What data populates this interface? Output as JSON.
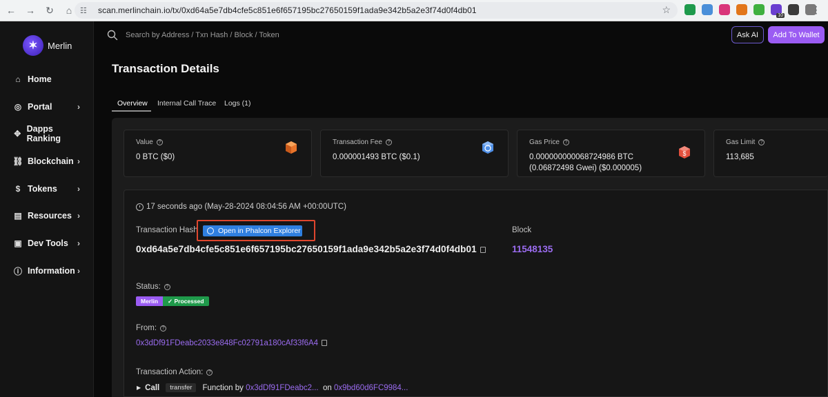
{
  "browser": {
    "url": "scan.merlinchain.io/tx/0xd64a5e7db4cfe5c851e6f657195bc27650159f1ada9e342b5a2e3f74d0f4db01",
    "extension_colors": [
      "#1e9a4c",
      "#4a8fd9",
      "#d9357a",
      "#e2761b",
      "#3fb03f",
      "#6a3fd0",
      "#3b3b3b",
      "#7a7a7a"
    ],
    "extension_badge": "10"
  },
  "brand": {
    "name": "Merlin",
    "accent": "#9b5cf3"
  },
  "sidebar": {
    "items": [
      {
        "label": "Home",
        "icon": "home-icon",
        "glyph": "⌂",
        "has_submenu": false
      },
      {
        "label": "Portal",
        "icon": "compass-icon",
        "glyph": "◎",
        "has_submenu": true
      },
      {
        "label": "Dapps Ranking",
        "icon": "dapps-icon",
        "glyph": "✥",
        "has_submenu": false
      },
      {
        "label": "Blockchain",
        "icon": "blockchain-icon",
        "glyph": "⛓",
        "has_submenu": true
      },
      {
        "label": "Tokens",
        "icon": "coin-icon",
        "glyph": "$",
        "has_submenu": true
      },
      {
        "label": "Resources",
        "icon": "resources-icon",
        "glyph": "▤",
        "has_submenu": true
      },
      {
        "label": "Dev Tools",
        "icon": "terminal-icon",
        "glyph": "▣",
        "has_submenu": true
      },
      {
        "label": "Information",
        "icon": "info-icon",
        "glyph": "ⓘ",
        "has_submenu": true
      }
    ]
  },
  "header": {
    "search_placeholder": "Search by Address / Txn Hash / Block / Token",
    "ask_ai_label": "Ask AI",
    "add_wallet_label": "Add To Wallet"
  },
  "page": {
    "title": "Transaction Details"
  },
  "tabs": [
    {
      "label": "Overview",
      "active": true
    },
    {
      "label": "Internal Call Trace",
      "active": false
    },
    {
      "label": "Logs (1)",
      "active": false
    }
  ],
  "stats": [
    {
      "label": "Value",
      "value": "0 BTC ($0)",
      "icon": "btc-cube-icon",
      "icon_color": "#e8742a"
    },
    {
      "label": "Transaction Fee",
      "value": "0.000001493 BTC ($0.1)",
      "icon": "fee-cube-icon",
      "icon_color": "#4f8fe6"
    },
    {
      "label": "Gas Price",
      "value_line1": "0.000000000068724986 BTC",
      "value_line2": "(0.06872498 Gwei) ($0.000005)",
      "icon": "gas-cube-icon",
      "icon_color": "#e24f3c"
    },
    {
      "label": "Gas Limit",
      "value": "113,685"
    }
  ],
  "details": {
    "timestamp": "17 seconds ago (May-28-2024 08:04:56 AM +00:00UTC)",
    "tx_hash_label": "Transaction Hash",
    "phalcon_label": "Open in Phalcon Explorer",
    "tx_hash": "0xd64a5e7db4cfe5c851e6f657195bc27650159f1ada9e342b5a2e3f74d0f4db01",
    "block_label": "Block",
    "block": "11548135",
    "status_label": "Status:",
    "status_chain": "Merlin",
    "status_value": "✓ Processed",
    "from_label": "From:",
    "from": "0x3dDf91FDeabc2033e848Fc02791a180cAf33f6A4",
    "action_label": "Transaction Action:",
    "action_verb": "Call",
    "action_fn": "transfer",
    "action_by": "Function by",
    "action_from_short": "0x3dDf91FDeabc2...",
    "action_on": "on",
    "action_to_short": "0x9bd60d6FC9984..."
  }
}
